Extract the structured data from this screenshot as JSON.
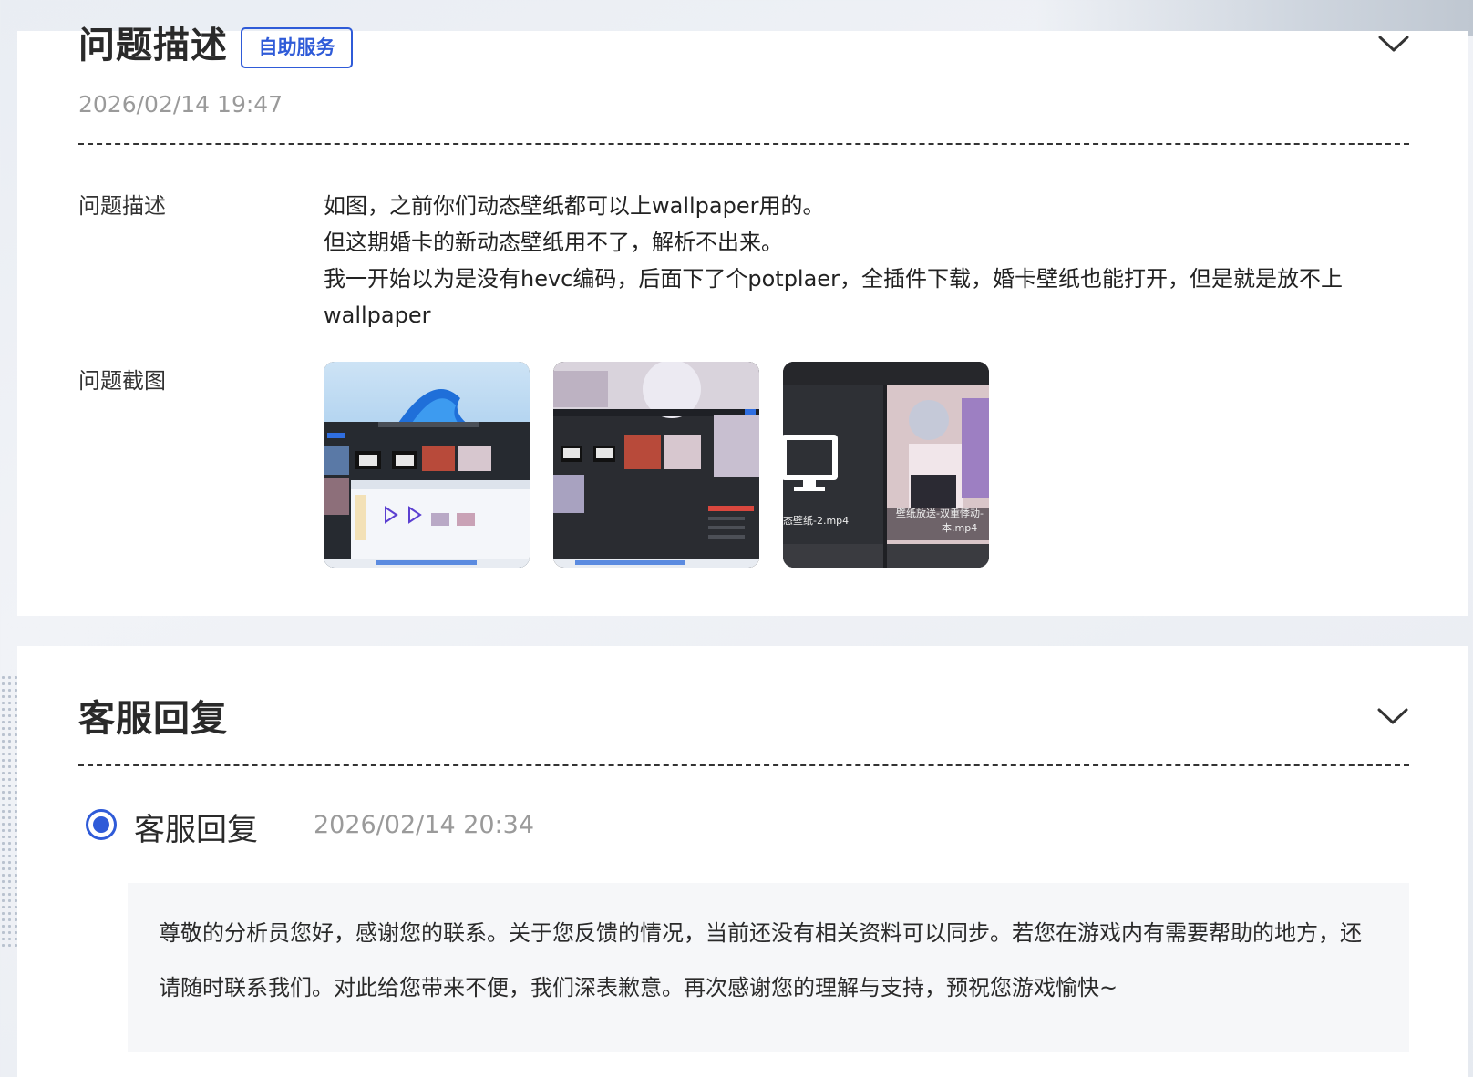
{
  "issue": {
    "title": "问题描述",
    "badge": "自助服务",
    "timestamp": "2026/02/14 19:47",
    "description_label": "问题描述",
    "description_lines": [
      "如图，之前你们动态壁纸都可以上wallpaper用的。",
      "但这期婚卡的新动态壁纸用不了，解析不出来。",
      "我一开始以为是没有hevc编码，后面下了个potplaer，全插件下载，婚卡壁纸也能打开，但是就是放不上wallpaper"
    ],
    "screenshot_label": "问题截图",
    "screenshots": [
      {
        "name": "screenshot-1"
      },
      {
        "name": "screenshot-2"
      },
      {
        "name": "screenshot-3",
        "captions": [
          "态壁纸-2.mp4",
          "壁纸放送-双重悸动-",
          "本.mp4"
        ]
      }
    ]
  },
  "reply": {
    "section_title": "客服回复",
    "author": "客服回复",
    "timestamp": "2026/02/14 20:34",
    "text": "尊敬的分析员您好，感谢您的联系。关于您反馈的情况，当前还没有相关资料可以同步。若您在游戏内有需要帮助的地方，还请随时联系我们。对此给您带来不便，我们深表歉意。再次感谢您的理解与支持，预祝您游戏愉快~"
  },
  "icons": {
    "collapse": "chevron-down-icon",
    "radio": "radio-selected-icon"
  },
  "colors": {
    "accent": "#2f5bd8",
    "muted_text": "#9a9a9a",
    "card_bg": "#ffffff",
    "reply_bg": "#f6f7f9"
  }
}
